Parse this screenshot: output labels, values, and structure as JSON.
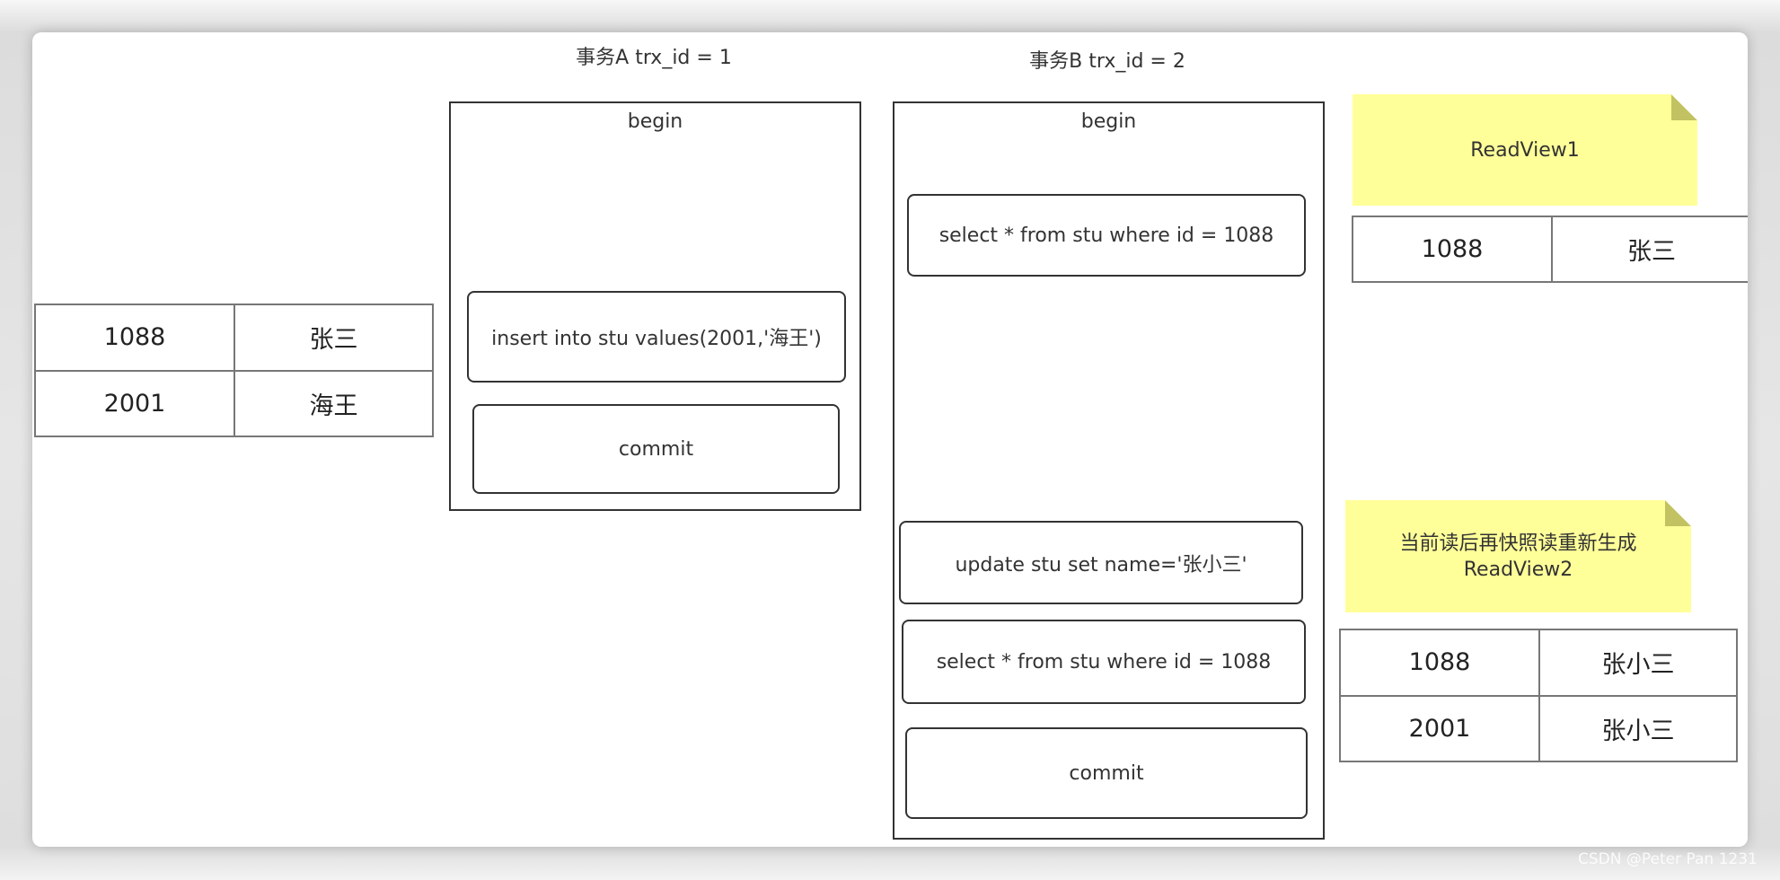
{
  "transactions": {
    "a": {
      "title": "事务A trx_id = 1",
      "begin_label": "begin",
      "statements": [
        "insert into stu values(2001,'海王')",
        "commit"
      ]
    },
    "b": {
      "title": "事务B trx_id = 2",
      "begin_label": "begin",
      "statements": [
        "select * from stu where id = 1088",
        "update stu set name='张小三'",
        "select * from stu where id = 1088",
        "commit"
      ]
    }
  },
  "base_table": {
    "rows": [
      [
        "1088",
        "张三"
      ],
      [
        "2001",
        "海王"
      ]
    ]
  },
  "read_views": [
    {
      "note": "ReadView1",
      "rows": [
        [
          "1088",
          "张三"
        ]
      ]
    },
    {
      "note_line1": "当前读后再快照读重新生成",
      "note_line2": "ReadView2",
      "rows": [
        [
          "1088",
          "张小三"
        ],
        [
          "2001",
          "张小三"
        ]
      ]
    }
  ],
  "colors": {
    "note_fill": "#ffff99",
    "note_fold": "#c2c262",
    "frame_stroke": "#333333",
    "table_stroke": "#777777"
  },
  "watermark": "CSDN @Peter Pan 1231"
}
